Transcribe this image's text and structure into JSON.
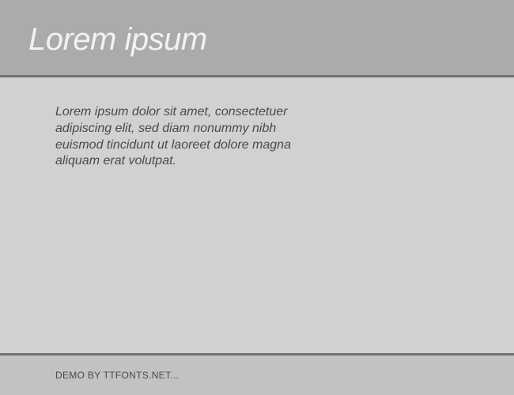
{
  "header": {
    "title": "Lorem ipsum"
  },
  "content": {
    "paragraph": "Lorem ipsum dolor sit amet, consectetuer adipiscing elit, sed diam nonummy nibh euismod tincidunt ut laoreet dolore magna aliquam erat volutpat."
  },
  "footer": {
    "text": "DEMO BY TTFONTS.NET..."
  }
}
